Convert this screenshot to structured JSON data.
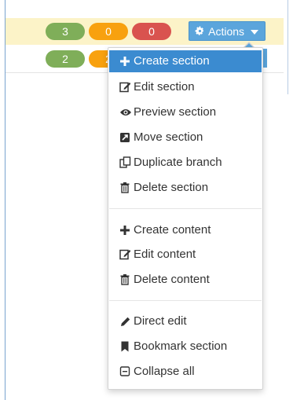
{
  "rows": [
    {
      "counts": [
        "3",
        "0",
        "0"
      ],
      "colors": [
        "#7fae59",
        "#f8a10f",
        "#d9534f"
      ]
    },
    {
      "counts": [
        "2",
        "2"
      ],
      "colors": [
        "#7fae59",
        "#f8a10f"
      ]
    }
  ],
  "actions": {
    "label": "Actions",
    "icon": "gear-icon",
    "accent": "#5ba5dc"
  },
  "menu": {
    "groups": [
      [
        {
          "label": "Create section",
          "icon": "plus-icon",
          "active": true
        },
        {
          "label": "Edit section",
          "icon": "edit-icon"
        },
        {
          "label": "Preview section",
          "icon": "eye-icon"
        },
        {
          "label": "Move section",
          "icon": "move-icon"
        },
        {
          "label": "Duplicate branch",
          "icon": "duplicate-icon"
        },
        {
          "label": "Delete section",
          "icon": "trash-icon"
        }
      ],
      [
        {
          "label": "Create content",
          "icon": "plus-icon"
        },
        {
          "label": "Edit content",
          "icon": "edit-icon"
        },
        {
          "label": "Delete content",
          "icon": "trash-icon"
        }
      ],
      [
        {
          "label": "Direct edit",
          "icon": "pencil-icon"
        },
        {
          "label": "Bookmark section",
          "icon": "bookmark-icon"
        },
        {
          "label": "Collapse all",
          "icon": "collapse-icon"
        }
      ]
    ]
  },
  "colors": {
    "highlight": "#3b8bd0",
    "row_highlight": "#fcf3c8"
  }
}
